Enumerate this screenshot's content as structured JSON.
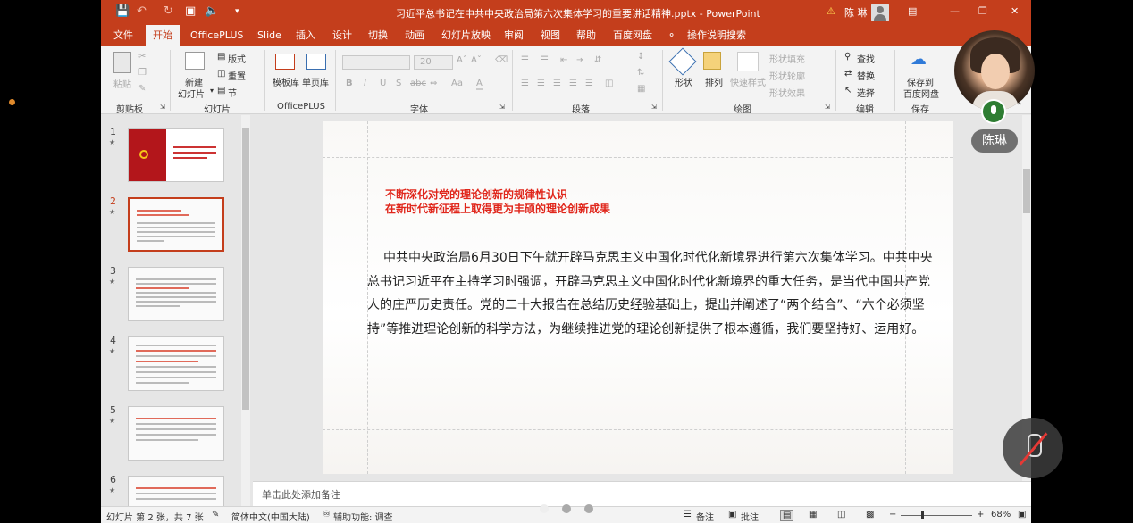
{
  "title_bar": {
    "doc_title": "习近平总书记在中共中央政治局第六次集体学习的重要讲话精神.pptx - PowerPoint",
    "warning_icon": "warning-icon",
    "user": "陈 琳"
  },
  "tabs": [
    "文件",
    "开始",
    "OfficePLUS",
    "iSlide",
    "插入",
    "设计",
    "切换",
    "动画",
    "幻灯片放映",
    "审阅",
    "视图",
    "帮助",
    "百度网盘",
    "操作说明搜索"
  ],
  "ribbon": {
    "clipboard": {
      "paste": "粘贴",
      "group": "剪贴板"
    },
    "slides": {
      "new_slide": "新建",
      "new_slide2": "幻灯片",
      "layout": "版式",
      "reset": "重置",
      "section": "节",
      "group": "幻灯片"
    },
    "officeplus": {
      "template": "模板库",
      "single": "单页库",
      "group": "OfficePLUS"
    },
    "font": {
      "size": "20",
      "bold": "B",
      "italic": "I",
      "underline": "U",
      "strike": "S",
      "spacing": "abc",
      "case": "Aa",
      "group": "字体"
    },
    "paragraph": {
      "group": "段落"
    },
    "drawing": {
      "shape": "形状",
      "arrange": "排列",
      "quick_style": "快速样式",
      "fill": "形状填充",
      "outline": "形状轮廓",
      "effect": "形状效果",
      "group": "绘图"
    },
    "editing": {
      "find": "查找",
      "replace": "替换",
      "select": "选择",
      "group": "编辑"
    },
    "save": {
      "save_to": "保存到",
      "baidu": "百度网盘",
      "group": "保存"
    }
  },
  "thumbnails": [
    {
      "num": "1"
    },
    {
      "num": "2"
    },
    {
      "num": "3"
    },
    {
      "num": "4"
    },
    {
      "num": "5"
    },
    {
      "num": "6"
    }
  ],
  "slide": {
    "headline1": "不断深化对党的理论创新的规律性认识",
    "headline2": "在新时代新征程上取得更为丰硕的理论创新成果",
    "body": "中共中央政治局6月30日下午就开辟马克思主义中国化时代化新境界进行第六次集体学习。中共中央总书记习近平在主持学习时强调，开辟马克思主义中国化时代化新境界的重大任务，是当代中国共产党人的庄严历史责任。党的二十大报告在总结历史经验基础上，提出并阐述了“两个结合”、“六个必须坚持”等推进理论创新的科学方法，为继续推进党的理论创新提供了根本遵循，我们要坚持好、运用好。"
  },
  "notes_placeholder": "单击此处添加备注",
  "status": {
    "slide_info": "幻灯片 第 2 张，共 7 张",
    "language": "简体中文(中国大陆)",
    "accessibility": "辅助功能: 调查",
    "notes": "备注",
    "comments": "批注",
    "zoom": "68%"
  },
  "overlay": {
    "participant": "陈琳"
  },
  "colors": {
    "accent": "#c43e1c",
    "headline": "#e0261b"
  }
}
